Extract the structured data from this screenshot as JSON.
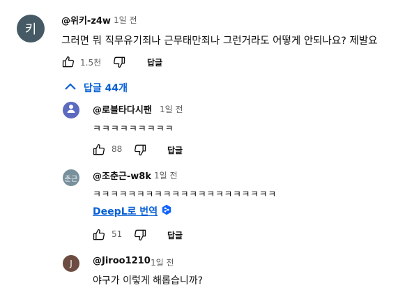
{
  "comment": {
    "avatar_letter": "키",
    "handle": "@위키-z4w",
    "time": "1일 전",
    "text": "그러면 뭐 직무유기죄나 근무태만죄나 그런거라도 어떻게 안되나요? 제발요",
    "likes": "1.5천",
    "reply_label": "답글"
  },
  "replies_toggle": {
    "label": "답글 44개",
    "icon": "chevron-up-icon"
  },
  "replies": [
    {
      "avatar_icon": "person-icon",
      "handle": "@로블타다시팬",
      "time": "1일 전",
      "text": "ㅋㅋㅋㅋㅋㅋㅋㅋㅋ",
      "likes": "88",
      "reply_label": "답글"
    },
    {
      "avatar_letter": "춘근",
      "handle": "@조춘근-w8k",
      "time": "1일 전",
      "text": "ㅋㅋㅋㅋㅋㅋㅋㅋㅋㅋㅋㅋㅋㅋㅋㅋㅋㅋㅋㅋㅋ",
      "translate_label": "DeepL로 번역",
      "likes": "51",
      "reply_label": "답글"
    },
    {
      "avatar_letter": "J",
      "handle": "@Jiroo1210",
      "time": "1일 전",
      "text": "야구가 이렇게 해롭습니까?"
    }
  ],
  "colors": {
    "link_blue": "#065fd4",
    "text": "#0f0f0f",
    "meta_grey": "#606060",
    "avatar_main": "#455a64",
    "avatar_reply1": "#5c6bc0",
    "avatar_reply2": "#78909c",
    "avatar_reply3": "#6d4c41",
    "deepl_blue": "#0f62fe"
  }
}
